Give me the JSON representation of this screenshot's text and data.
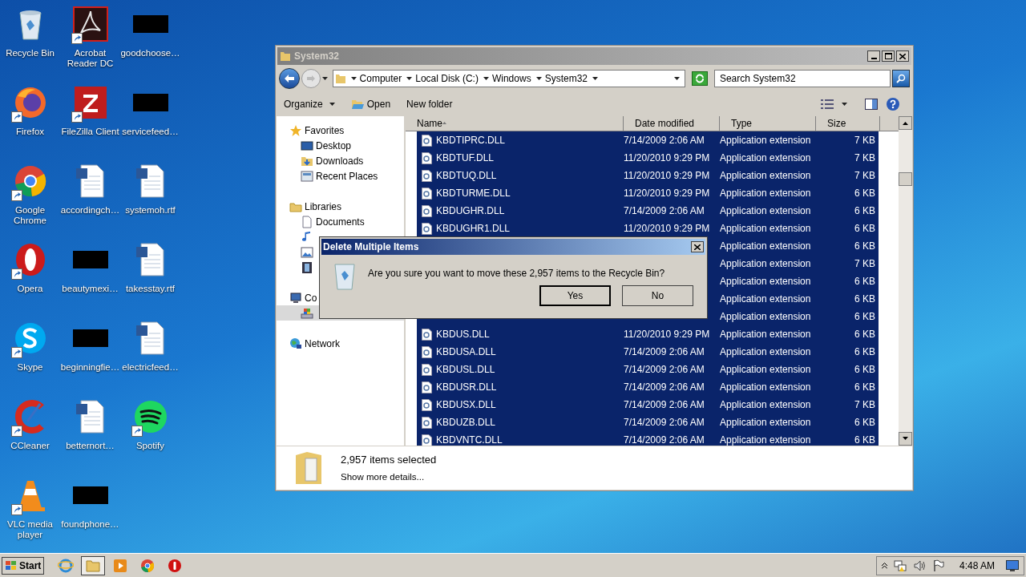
{
  "desktop_icons": [
    {
      "label": "Recycle Bin",
      "kind": "recycle",
      "shortcut": false
    },
    {
      "label": "Acrobat Reader DC",
      "kind": "acrobat",
      "shortcut": true
    },
    {
      "label": "goodchoose…",
      "kind": "redacted",
      "shortcut": false
    },
    {
      "label": "Firefox",
      "kind": "firefox",
      "shortcut": true
    },
    {
      "label": "FileZilla Client",
      "kind": "filezilla",
      "shortcut": true
    },
    {
      "label": "servicefeed…",
      "kind": "redacted",
      "shortcut": false
    },
    {
      "label": "Google Chrome",
      "kind": "chrome",
      "shortcut": true
    },
    {
      "label": "accordingch…",
      "kind": "word",
      "shortcut": false
    },
    {
      "label": "systemoh.rtf",
      "kind": "word",
      "shortcut": false
    },
    {
      "label": "Opera",
      "kind": "opera",
      "shortcut": true
    },
    {
      "label": "beautymexi…",
      "kind": "redacted",
      "shortcut": false
    },
    {
      "label": "takesstay.rtf",
      "kind": "word",
      "shortcut": false
    },
    {
      "label": "Skype",
      "kind": "skype",
      "shortcut": true
    },
    {
      "label": "beginningfie…",
      "kind": "redacted",
      "shortcut": false
    },
    {
      "label": "electricfeed…",
      "kind": "word",
      "shortcut": false
    },
    {
      "label": "CCleaner",
      "kind": "ccleaner",
      "shortcut": true
    },
    {
      "label": "betternort…",
      "kind": "word",
      "shortcut": false
    },
    {
      "label": "Spotify",
      "kind": "spotify",
      "shortcut": true
    },
    {
      "label": "VLC media player",
      "kind": "vlc",
      "shortcut": true
    },
    {
      "label": "foundphone…",
      "kind": "redacted",
      "shortcut": false
    }
  ],
  "window": {
    "title": "System32",
    "breadcrumb": [
      "Computer",
      "Local Disk (C:)",
      "Windows",
      "System32"
    ],
    "search": {
      "placeholder": "Search System32"
    },
    "toolbar": [
      {
        "label": "Organize",
        "kind": "menu"
      },
      {
        "label": "Open",
        "kind": "open"
      },
      {
        "label": "New folder",
        "kind": "plain"
      }
    ],
    "nav": [
      {
        "label": "Favorites",
        "kind": "star",
        "selected": false,
        "children": [
          {
            "label": "Desktop",
            "kind": "desktop",
            "selected": false
          },
          {
            "label": "Downloads",
            "kind": "downloads",
            "selected": false
          },
          {
            "label": "Recent Places",
            "kind": "recent",
            "selected": false
          }
        ]
      },
      {
        "label": "Libraries",
        "kind": "library",
        "selected": false,
        "children": [
          {
            "label": "Documents",
            "kind": "documents",
            "selected": false
          },
          {
            "kind": "music",
            "selected": false
          },
          {
            "kind": "pictures",
            "selected": false
          },
          {
            "kind": "videos",
            "selected": false
          }
        ]
      },
      {
        "label": "Co",
        "kind": "computer",
        "selected": false,
        "children": [
          {
            "kind": "disk",
            "selected": true
          }
        ]
      },
      {
        "label": "Network",
        "kind": "network",
        "selected": false
      }
    ],
    "columns": [
      {
        "label": "Name",
        "sorted": true
      },
      {
        "label": "Date modified",
        "sorted": false
      },
      {
        "label": "Type",
        "sorted": false
      },
      {
        "label": "Size",
        "sorted": false
      }
    ],
    "rows": [
      {
        "name": "KBDTIPRC.DLL",
        "date": "7/14/2009 2:06 AM",
        "type": "Application extension",
        "size": "7 KB",
        "selected": true
      },
      {
        "name": "KBDTUF.DLL",
        "date": "11/20/2010 9:29 PM",
        "type": "Application extension",
        "size": "7 KB",
        "selected": true
      },
      {
        "name": "KBDTUQ.DLL",
        "date": "11/20/2010 9:29 PM",
        "type": "Application extension",
        "size": "7 KB",
        "selected": true
      },
      {
        "name": "KBDTURME.DLL",
        "date": "11/20/2010 9:29 PM",
        "type": "Application extension",
        "size": "6 KB",
        "selected": true
      },
      {
        "name": "KBDUGHR.DLL",
        "date": "7/14/2009 2:06 AM",
        "type": "Application extension",
        "size": "6 KB",
        "selected": true
      },
      {
        "name": "KBDUGHR1.DLL",
        "date": "11/20/2010 9:29 PM",
        "type": "Application extension",
        "size": "6 KB",
        "selected": true
      },
      {
        "type": "Application extension",
        "size": "6 KB",
        "selected": true
      },
      {
        "type": "Application extension",
        "size": "7 KB",
        "selected": true
      },
      {
        "type": "Application extension",
        "size": "6 KB",
        "selected": true
      },
      {
        "type": "Application extension",
        "size": "6 KB",
        "selected": true
      },
      {
        "type": "Application extension",
        "size": "6 KB",
        "selected": true
      },
      {
        "name": "KBDUS.DLL",
        "date": "11/20/2010 9:29 PM",
        "type": "Application extension",
        "size": "6 KB",
        "selected": true
      },
      {
        "name": "KBDUSA.DLL",
        "date": "7/14/2009 2:06 AM",
        "type": "Application extension",
        "size": "6 KB",
        "selected": true
      },
      {
        "name": "KBDUSL.DLL",
        "date": "7/14/2009 2:06 AM",
        "type": "Application extension",
        "size": "6 KB",
        "selected": true
      },
      {
        "name": "KBDUSR.DLL",
        "date": "7/14/2009 2:06 AM",
        "type": "Application extension",
        "size": "6 KB",
        "selected": true
      },
      {
        "name": "KBDUSX.DLL",
        "date": "7/14/2009 2:06 AM",
        "type": "Application extension",
        "size": "7 KB",
        "selected": true
      },
      {
        "name": "KBDUZB.DLL",
        "date": "7/14/2009 2:06 AM",
        "type": "Application extension",
        "size": "6 KB",
        "selected": true
      },
      {
        "name": "KBDVNTC.DLL",
        "date": "7/14/2009 2:06 AM",
        "type": "Application extension",
        "size": "6 KB",
        "selected": true
      }
    ],
    "details": {
      "summary": "2,957 items selected",
      "link": "Show more details..."
    }
  },
  "dialog": {
    "title": "Delete Multiple Items",
    "message": "Are you sure you want to move these 2,957 items to the Recycle Bin?",
    "buttons": [
      {
        "label": "Yes",
        "default": true
      },
      {
        "label": "No",
        "default": false
      }
    ]
  },
  "taskbar": {
    "start": "Start",
    "apps": [
      {
        "kind": "ie",
        "active": false
      },
      {
        "kind": "explorer",
        "active": true
      },
      {
        "kind": "media",
        "active": false
      },
      {
        "kind": "chrome",
        "active": false
      },
      {
        "kind": "stop",
        "active": false
      }
    ],
    "clock": "4:48 AM"
  }
}
